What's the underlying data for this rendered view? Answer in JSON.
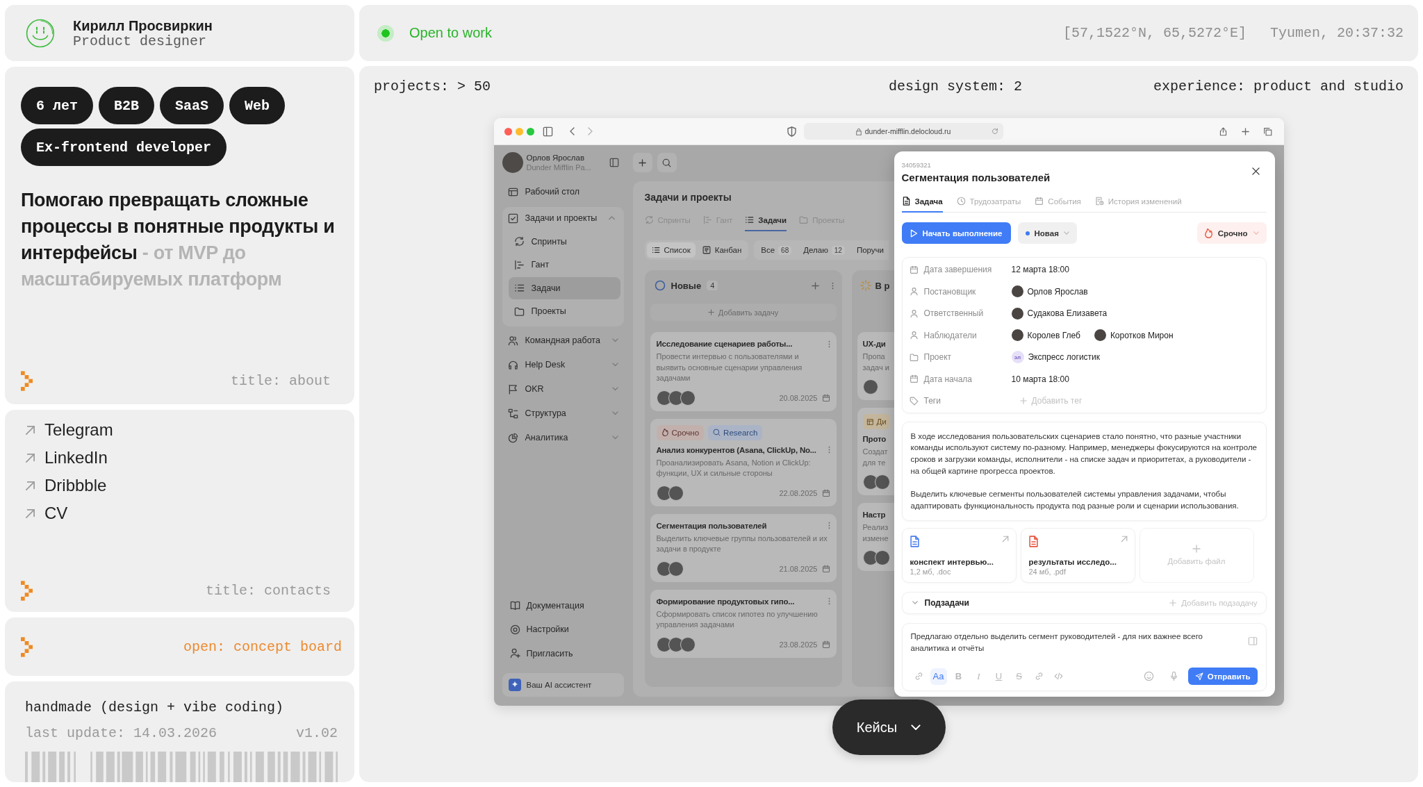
{
  "profile": {
    "name": "Кирилл Просвиркин",
    "role": "Product designer"
  },
  "status": {
    "available": true,
    "label": "Open to work",
    "coordinates": "[57,1522°N, 65,5272°E]",
    "place_time": "Tyumen, 20:37:32"
  },
  "about": {
    "tags": [
      "6 лет",
      "B2B",
      "SaaS",
      "Web",
      "Ex-frontend developer"
    ],
    "headline": {
      "main": "Помогаю превращать сложные процессы в понятные продукты и интерфейсы",
      "muted": "- от MVP до масштабируемых платформ"
    },
    "caption": "title: about"
  },
  "contacts": {
    "links": [
      "Telegram",
      "LinkedIn",
      "Dribbble",
      "CV"
    ],
    "caption": "title: contacts"
  },
  "concept_board": {
    "link": "open: concept board"
  },
  "colophon": {
    "credit": "handmade (design + vibe coding)",
    "last_update": "last update: 14.03.2026",
    "version": "v1.02"
  },
  "stats": [
    "projects: > 50",
    "design system: 2",
    "experience: product and studio"
  ],
  "showcase": {
    "browser": {
      "url": "dunder-mifflin.delocloud.ru"
    },
    "app": {
      "user": {
        "name": "Орлов Ярослав",
        "company": "Dunder Mifflin Pa..."
      },
      "nav": [
        {
          "label": "Рабочий стол",
          "selected": false
        },
        {
          "label": "Задачи и проекты",
          "selected": false,
          "expanded": true,
          "children": [
            {
              "label": "Спринты",
              "selected": false
            },
            {
              "label": "Гант",
              "selected": false
            },
            {
              "label": "Задачи",
              "selected": true
            },
            {
              "label": "Проекты",
              "selected": false
            }
          ]
        },
        {
          "label": "Командная работа",
          "selected": false,
          "expanded": false
        },
        {
          "label": "Help Desk",
          "selected": false,
          "expanded": false
        },
        {
          "label": "OKR",
          "selected": false,
          "expanded": false
        },
        {
          "label": "Структура",
          "selected": false,
          "expanded": false
        },
        {
          "label": "Аналитика",
          "selected": false,
          "expanded": false
        }
      ],
      "nav_bottom": [
        {
          "label": "Документация",
          "selected": false
        },
        {
          "label": "Настройки",
          "selected": false
        },
        {
          "label": "Пригласить",
          "selected": false
        }
      ],
      "assistant": "Ваш AI ассистент",
      "page_title": "Задачи и проекты",
      "tabs": [
        {
          "label": "Спринты",
          "selected": false
        },
        {
          "label": "Гант",
          "selected": false
        },
        {
          "label": "Задачи",
          "selected": true
        },
        {
          "label": "Проекты",
          "selected": false
        }
      ],
      "views": [
        {
          "label": "Список",
          "selected": true
        },
        {
          "label": "Канбан",
          "selected": false
        }
      ],
      "filters": [
        {
          "label": "Все",
          "count": "68",
          "selected": false
        },
        {
          "label": "Делаю",
          "count": "12",
          "selected": false
        },
        {
          "label": "Поручи",
          "selected": false
        }
      ],
      "columns": [
        {
          "kind": "new",
          "title": "Новые",
          "count": "4",
          "add_label": "Добавить задачу",
          "cards": [
            {
              "title": "Исследование сценариев работы...",
              "description": "Провести интервью с пользователями и выявить основные сценарии управления задачами",
              "assignees": [
                {
                  "kind": "photo"
                },
                {
                  "kind": "photo"
                },
                {
                  "kind": "photo"
                }
              ],
              "date": "20.08.2025"
            },
            {
              "tags": [
                {
                  "kind": "urgent",
                  "label": "Срочно"
                },
                {
                  "kind": "research",
                  "label": "Research"
                }
              ],
              "title": "Анализ конкурентов (Asana, ClickUp, No...",
              "description": "Проанализировать Asana, Notion и ClickUp: функции, UX и сильные стороны",
              "assignees": [
                {
                  "kind": "photo"
                },
                {
                  "kind": "photo"
                }
              ],
              "date": "22.08.2025"
            },
            {
              "title": "Сегментация пользователей",
              "description": "Выделить ключевые группы пользователей и их задачи в продукте",
              "assignees": [
                {
                  "kind": "photo"
                },
                {
                  "kind": "photo"
                }
              ],
              "date": "21.08.2025"
            },
            {
              "title": "Формирование продуктовых гипо...",
              "description": "Сформировать список гипотез по улучшению управления задачами",
              "assignees": [
                {
                  "kind": "photo"
                },
                {
                  "kind": "photo"
                },
                {
                  "kind": "photo"
                }
              ],
              "date": "23.08.2025"
            }
          ]
        },
        {
          "kind": "in_progress",
          "title": "В р",
          "cards": [
            {
              "title": "UX-ди",
              "lines": [
                "Пропа",
                "задач и"
              ],
              "assignees": [
                {
                  "kind": "photo"
                }
              ]
            },
            {
              "tags": [
                {
                  "kind": "design",
                  "label": "Ди"
                }
              ],
              "title": "Прото",
              "lines": [
                "Создат",
                "для те"
              ],
              "assignees": [
                {
                  "kind": "photo"
                },
                {
                  "kind": "photo"
                }
              ]
            },
            {
              "title": "Настр",
              "lines": [
                "Реализ",
                "измене"
              ],
              "assignees": [
                {
                  "kind": "photo"
                },
                {
                  "kind": "photo"
                }
              ]
            }
          ]
        }
      ]
    },
    "task": {
      "id": "34059321",
      "title": "Сегментация пользователей",
      "tabs": [
        {
          "label": "Задача",
          "selected": true
        },
        {
          "label": "Трудозатраты",
          "selected": false
        },
        {
          "label": "События",
          "selected": false
        },
        {
          "label": "История изменений",
          "selected": false
        }
      ],
      "start_button": "Начать выполнение",
      "status": "Новая",
      "priority": "Срочно",
      "fields": [
        {
          "kind": "date",
          "label": "Дата завершения",
          "value": "12 марта 18:00"
        },
        {
          "kind": "people",
          "label": "Постановщик",
          "people": [
            "Орлов Ярослав"
          ]
        },
        {
          "kind": "people",
          "label": "Ответственный",
          "people": [
            "Судакова Елизавета"
          ]
        },
        {
          "kind": "people",
          "label": "Наблюдатели",
          "people": [
            "Королев Глеб",
            "Коротков Мирон"
          ]
        },
        {
          "kind": "project",
          "label": "Проект",
          "badge": "эл",
          "value": "Экспресс логистик"
        },
        {
          "kind": "date",
          "label": "Дата начала",
          "value": "10 марта 18:00"
        },
        {
          "kind": "add",
          "label": "Теги",
          "value": "Добавить тег"
        }
      ],
      "description": [
        "В ходе исследования пользовательских сценариев стало понятно, что разные участники команды используют систему по-разному. Например, менеджеры фокусируются на контроле сроков и загрузки команды, исполнители - на списке задач и приоритетах, а руководители - на общей картине прогресса проектов.",
        "Выделить ключевые сегменты пользователей системы управления задачами, чтобы адаптировать функциональность продукта под разные роли и сценарии использования."
      ],
      "files": [
        {
          "kind": "doc",
          "name": "конспект интервью...",
          "meta": "1,2 мб, .doc"
        },
        {
          "kind": "pdf",
          "name": "результаты исследо...",
          "meta": "24 мб, .pdf"
        }
      ],
      "add_file": "Добавить файл",
      "subtasks": {
        "label": "Подзадачи",
        "add_label": "Добавить подзадачу"
      },
      "comment": "Предлагаю отдельно выделить сегмент руководителей - для них важнее всего аналитика и отчёты",
      "format_buttons": [
        {
          "kind": "font",
          "label": "Aa",
          "selected": true
        },
        {
          "kind": "bold",
          "label": "B",
          "selected": false
        },
        {
          "kind": "italic",
          "label": "I",
          "selected": false
        },
        {
          "kind": "underline",
          "label": "U",
          "selected": false
        },
        {
          "kind": "strike",
          "label": "S",
          "selected": false
        }
      ],
      "send_button": "Отправить"
    },
    "cases_button": "Кейсы"
  }
}
